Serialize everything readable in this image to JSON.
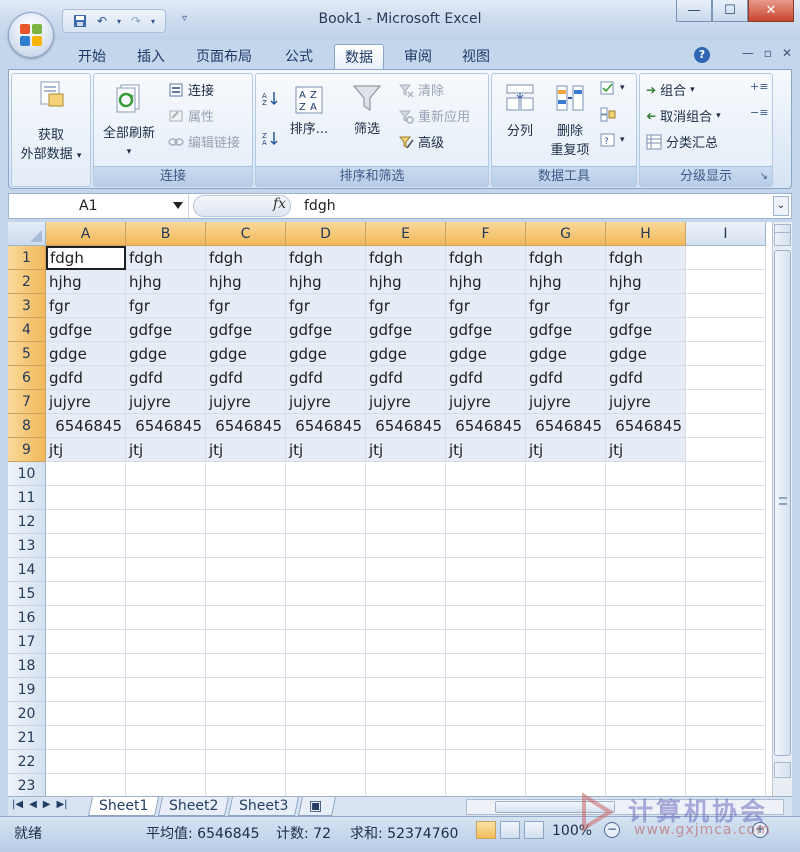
{
  "window": {
    "title": "Book1 - Microsoft Excel"
  },
  "ribbon_tabs": [
    "开始",
    "插入",
    "页面布局",
    "公式",
    "数据",
    "审阅",
    "视图"
  ],
  "active_tab_index": 4,
  "groups": {
    "external": {
      "button_line1": "获取",
      "button_line2": "外部数据"
    },
    "connections": {
      "label": "连接",
      "refresh_all": "全部刷新",
      "connections": "连接",
      "properties": "属性",
      "edit_links": "编辑链接"
    },
    "sort_filter": {
      "label": "排序和筛选",
      "sort": "排序...",
      "filter": "筛选",
      "clear": "清除",
      "reapply": "重新应用",
      "advanced": "高级"
    },
    "data_tools": {
      "label": "数据工具",
      "text_to_columns": "分列",
      "remove_dup_line1": "删除",
      "remove_dup_line2": "重复项"
    },
    "outline": {
      "label": "分级显示",
      "group": "组合",
      "ungroup": "取消组合",
      "subtotal": "分类汇总"
    }
  },
  "formula_bar": {
    "name_box": "A1",
    "fx": "fx",
    "value": "fdgh"
  },
  "columns": [
    "A",
    "B",
    "C",
    "D",
    "E",
    "F",
    "G",
    "H",
    "I"
  ],
  "rows": [
    "1",
    "2",
    "3",
    "4",
    "5",
    "6",
    "7",
    "8",
    "9",
    "10",
    "11",
    "12",
    "13",
    "14",
    "15",
    "16",
    "17",
    "18",
    "19",
    "20",
    "21",
    "22",
    "23"
  ],
  "cells": [
    [
      "fdgh",
      "fdgh",
      "fdgh",
      "fdgh",
      "fdgh",
      "fdgh",
      "fdgh",
      "fdgh"
    ],
    [
      "hjhg",
      "hjhg",
      "hjhg",
      "hjhg",
      "hjhg",
      "hjhg",
      "hjhg",
      "hjhg"
    ],
    [
      "fgr",
      "fgr",
      "fgr",
      "fgr",
      "fgr",
      "fgr",
      "fgr",
      "fgr"
    ],
    [
      "gdfge",
      "gdfge",
      "gdfge",
      "gdfge",
      "gdfge",
      "gdfge",
      "gdfge",
      "gdfge"
    ],
    [
      "gdge",
      "gdge",
      "gdge",
      "gdge",
      "gdge",
      "gdge",
      "gdge",
      "gdge"
    ],
    [
      "gdfd",
      "gdfd",
      "gdfd",
      "gdfd",
      "gdfd",
      "gdfd",
      "gdfd",
      "gdfd"
    ],
    [
      "jujyre",
      "jujyre",
      "jujyre",
      "jujyre",
      "jujyre",
      "jujyre",
      "jujyre",
      "jujyre"
    ],
    [
      "6546845",
      "6546845",
      "6546845",
      "6546845",
      "6546845",
      "6546845",
      "6546845",
      "6546845"
    ],
    [
      "jtj",
      "jtj",
      "jtj",
      "jtj",
      "jtj",
      "jtj",
      "jtj",
      "jtj"
    ]
  ],
  "sheets": [
    "Sheet1",
    "Sheet2",
    "Sheet3"
  ],
  "status": {
    "ready": "就绪",
    "average": "平均值: 6546845",
    "count": "计数: 72",
    "sum": "求和: 52374760",
    "zoom": "100%"
  },
  "watermark": {
    "text": "计算机协会",
    "url": "www.gxjmca.com"
  },
  "colors": {
    "selected_header": "#f1b85a",
    "ribbon": "#e2ecf7",
    "selection": "#e6ecf5"
  }
}
